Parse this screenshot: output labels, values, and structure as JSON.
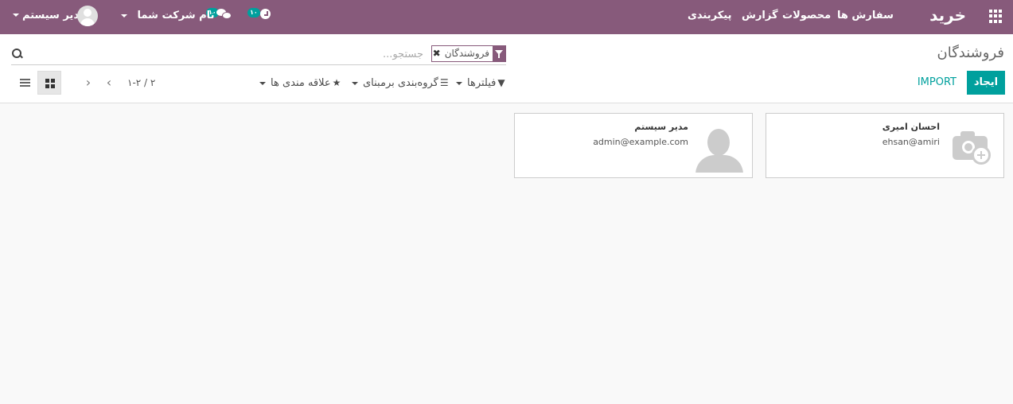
{
  "navbar": {
    "brand": "خرید",
    "menu": {
      "orders": "سفارش ها",
      "products": "محصولات",
      "report": "گزارش",
      "config": "پیکربندی"
    },
    "activity_badge": "۱۰",
    "messages_badge": "۱۰",
    "company": "نام شرکت شما",
    "user": "مدیر سیستم"
  },
  "control_panel": {
    "title": "فروشندگان",
    "search": {
      "facet_value": "فروشندگان",
      "facet_remove": "✖",
      "placeholder": "جستجو..."
    },
    "buttons": {
      "create": "ایجاد",
      "import": "IMPORT"
    },
    "search_options": {
      "filters": "فیلترها",
      "groupby": "گروه‌بندی برمبنای",
      "favorites": "علاقه مندی ها"
    },
    "pager": {
      "value": "۱-۲ / ۲",
      "prev": "‹",
      "next": "›"
    }
  },
  "kanban": {
    "records": [
      {
        "name": "احسان امیری",
        "email": "ehsan@amiri",
        "image": "camera-placeholder-icon"
      },
      {
        "name": "مدیر سیستم",
        "email": "admin@example.com",
        "image": "person-placeholder-icon"
      }
    ]
  },
  "colors": {
    "navbar": "#875a7b",
    "primary": "#00a09d",
    "background": "#f9f9f9"
  }
}
